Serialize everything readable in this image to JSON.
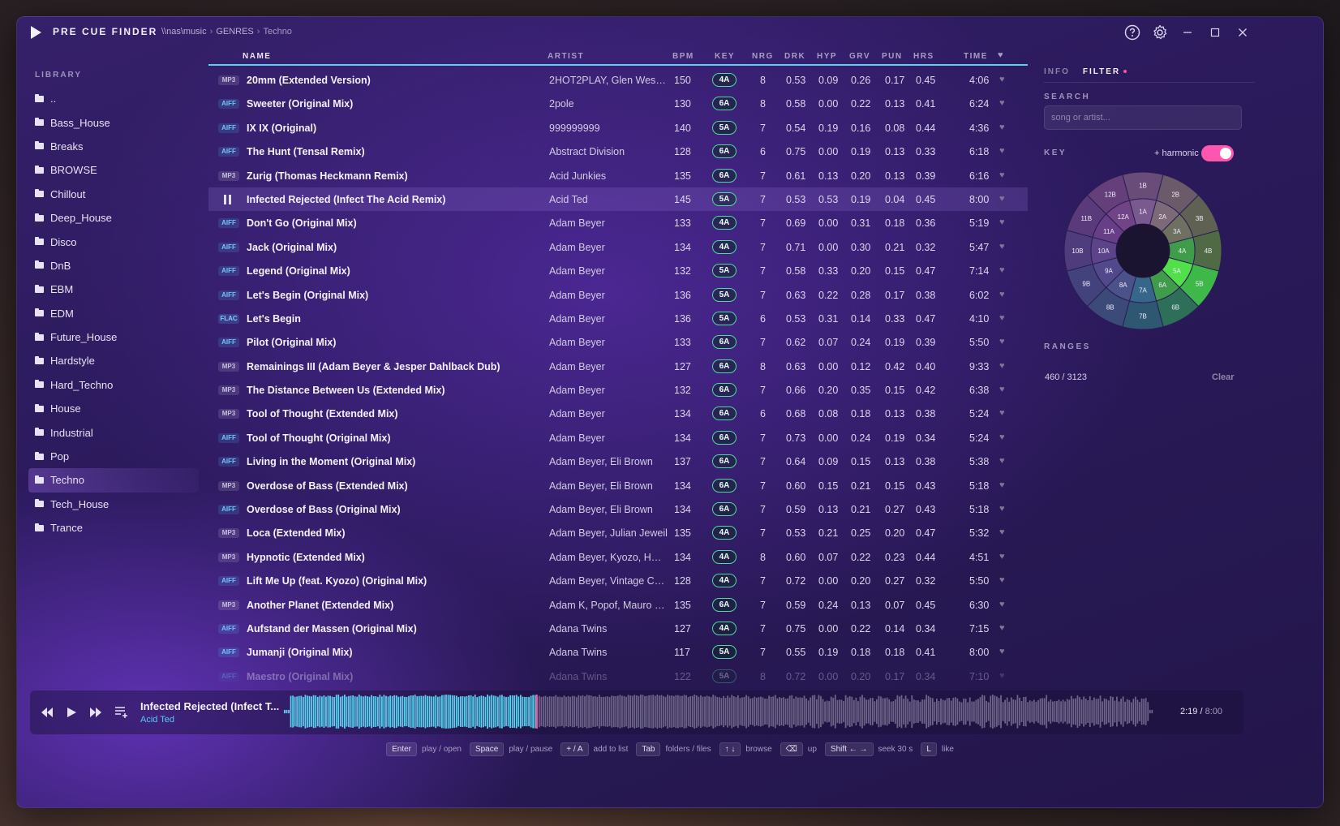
{
  "app": {
    "title": "PRE CUE FINDER"
  },
  "breadcrumb": [
    "\\\\nas\\music",
    "GENRES",
    "Techno"
  ],
  "library": {
    "heading": "LIBRARY",
    "items": [
      "..",
      "Bass_House",
      "Breaks",
      "BROWSE",
      "Chillout",
      "Deep_House",
      "Disco",
      "DnB",
      "EBM",
      "EDM",
      "Future_House",
      "Hardstyle",
      "Hard_Techno",
      "House",
      "Industrial",
      "Pop",
      "Techno",
      "Tech_House",
      "Trance"
    ],
    "active": "Techno"
  },
  "table": {
    "headers": {
      "name": "NAME",
      "artist": "ARTIST",
      "bpm": "BPM",
      "key": "KEY",
      "nrg": "NRG",
      "drk": "DRK",
      "hyp": "HYP",
      "grv": "GRV",
      "pun": "PUN",
      "hrs": "HRS",
      "time": "TIME"
    },
    "rows": [
      {
        "fmt": "MP3",
        "name": "20mm (Extended Version)",
        "artist": "2HOT2PLAY, Glen West ...",
        "bpm": "150",
        "key": "4A",
        "nrg": "8",
        "drk": "0.53",
        "hyp": "0.09",
        "grv": "0.26",
        "pun": "0.17",
        "hrs": "0.45",
        "time": "4:06"
      },
      {
        "fmt": "AIFF",
        "name": "Sweeter (Original Mix)",
        "artist": "2pole",
        "bpm": "130",
        "key": "6A",
        "nrg": "8",
        "drk": "0.58",
        "hyp": "0.00",
        "grv": "0.22",
        "pun": "0.13",
        "hrs": "0.41",
        "time": "6:24"
      },
      {
        "fmt": "AIFF",
        "name": "IX IX (Original)",
        "artist": "999999999",
        "bpm": "140",
        "key": "5A",
        "nrg": "7",
        "drk": "0.54",
        "hyp": "0.19",
        "grv": "0.16",
        "pun": "0.08",
        "hrs": "0.44",
        "time": "4:36"
      },
      {
        "fmt": "AIFF",
        "name": "The Hunt (Tensal Remix)",
        "artist": "Abstract Division",
        "bpm": "128",
        "key": "6A",
        "nrg": "6",
        "drk": "0.75",
        "hyp": "0.00",
        "grv": "0.19",
        "pun": "0.13",
        "hrs": "0.33",
        "time": "6:18"
      },
      {
        "fmt": "MP3",
        "name": "Zurig (Thomas Heckmann Remix)",
        "artist": "Acid Junkies",
        "bpm": "135",
        "key": "6A",
        "nrg": "7",
        "drk": "0.61",
        "hyp": "0.13",
        "grv": "0.20",
        "pun": "0.13",
        "hrs": "0.39",
        "time": "6:16"
      },
      {
        "fmt": "PLAYING",
        "name": "Infected Rejected (Infect The Acid Remix)",
        "artist": "Acid Ted",
        "bpm": "145",
        "key": "5A",
        "nrg": "7",
        "drk": "0.53",
        "hyp": "0.53",
        "grv": "0.19",
        "pun": "0.04",
        "hrs": "0.45",
        "time": "8:00"
      },
      {
        "fmt": "AIFF",
        "name": "Don't Go (Original Mix)",
        "artist": "Adam Beyer",
        "bpm": "133",
        "key": "4A",
        "nrg": "7",
        "drk": "0.69",
        "hyp": "0.00",
        "grv": "0.31",
        "pun": "0.18",
        "hrs": "0.36",
        "time": "5:19"
      },
      {
        "fmt": "AIFF",
        "name": "Jack (Original Mix)",
        "artist": "Adam Beyer",
        "bpm": "134",
        "key": "4A",
        "nrg": "7",
        "drk": "0.71",
        "hyp": "0.00",
        "grv": "0.30",
        "pun": "0.21",
        "hrs": "0.32",
        "time": "5:47"
      },
      {
        "fmt": "AIFF",
        "name": "Legend (Original Mix)",
        "artist": "Adam Beyer",
        "bpm": "132",
        "key": "5A",
        "nrg": "7",
        "drk": "0.58",
        "hyp": "0.33",
        "grv": "0.20",
        "pun": "0.15",
        "hrs": "0.47",
        "time": "7:14"
      },
      {
        "fmt": "AIFF",
        "name": "Let's Begin (Original Mix)",
        "artist": "Adam Beyer",
        "bpm": "136",
        "key": "5A",
        "nrg": "7",
        "drk": "0.63",
        "hyp": "0.22",
        "grv": "0.28",
        "pun": "0.17",
        "hrs": "0.38",
        "time": "6:02"
      },
      {
        "fmt": "FLAC",
        "name": "Let's Begin",
        "artist": "Adam Beyer",
        "bpm": "136",
        "key": "5A",
        "nrg": "6",
        "drk": "0.53",
        "hyp": "0.31",
        "grv": "0.14",
        "pun": "0.33",
        "hrs": "0.47",
        "time": "4:10"
      },
      {
        "fmt": "AIFF",
        "name": "Pilot (Original Mix)",
        "artist": "Adam Beyer",
        "bpm": "133",
        "key": "6A",
        "nrg": "7",
        "drk": "0.62",
        "hyp": "0.07",
        "grv": "0.24",
        "pun": "0.19",
        "hrs": "0.39",
        "time": "5:50"
      },
      {
        "fmt": "MP3",
        "name": "Remainings III (Adam Beyer & Jesper Dahlback Dub)",
        "artist": "Adam Beyer",
        "bpm": "127",
        "key": "6A",
        "nrg": "8",
        "drk": "0.63",
        "hyp": "0.00",
        "grv": "0.12",
        "pun": "0.42",
        "hrs": "0.40",
        "time": "9:33"
      },
      {
        "fmt": "MP3",
        "name": "The Distance Between Us (Extended Mix)",
        "artist": "Adam Beyer",
        "bpm": "132",
        "key": "6A",
        "nrg": "7",
        "drk": "0.66",
        "hyp": "0.20",
        "grv": "0.35",
        "pun": "0.15",
        "hrs": "0.42",
        "time": "6:38"
      },
      {
        "fmt": "MP3",
        "name": "Tool of Thought (Extended Mix)",
        "artist": "Adam Beyer",
        "bpm": "134",
        "key": "6A",
        "nrg": "6",
        "drk": "0.68",
        "hyp": "0.08",
        "grv": "0.18",
        "pun": "0.13",
        "hrs": "0.38",
        "time": "5:24"
      },
      {
        "fmt": "AIFF",
        "name": "Tool of Thought (Original Mix)",
        "artist": "Adam Beyer",
        "bpm": "134",
        "key": "6A",
        "nrg": "7",
        "drk": "0.73",
        "hyp": "0.00",
        "grv": "0.24",
        "pun": "0.19",
        "hrs": "0.34",
        "time": "5:24"
      },
      {
        "fmt": "AIFF",
        "name": "Living in the Moment (Original Mix)",
        "artist": "Adam Beyer, Eli Brown",
        "bpm": "137",
        "key": "6A",
        "nrg": "7",
        "drk": "0.64",
        "hyp": "0.09",
        "grv": "0.15",
        "pun": "0.13",
        "hrs": "0.38",
        "time": "5:38"
      },
      {
        "fmt": "MP3",
        "name": "Overdose of Bass (Extended Mix)",
        "artist": "Adam Beyer, Eli Brown",
        "bpm": "134",
        "key": "6A",
        "nrg": "7",
        "drk": "0.60",
        "hyp": "0.15",
        "grv": "0.21",
        "pun": "0.15",
        "hrs": "0.43",
        "time": "5:18"
      },
      {
        "fmt": "AIFF",
        "name": "Overdose of Bass (Original Mix)",
        "artist": "Adam Beyer, Eli Brown",
        "bpm": "134",
        "key": "6A",
        "nrg": "7",
        "drk": "0.59",
        "hyp": "0.13",
        "grv": "0.21",
        "pun": "0.27",
        "hrs": "0.43",
        "time": "5:18"
      },
      {
        "fmt": "MP3",
        "name": "Loca (Extended Mix)",
        "artist": "Adam Beyer, Julian Jeweil",
        "bpm": "135",
        "key": "4A",
        "nrg": "7",
        "drk": "0.53",
        "hyp": "0.21",
        "grv": "0.25",
        "pun": "0.20",
        "hrs": "0.47",
        "time": "5:32"
      },
      {
        "fmt": "MP3",
        "name": "Hypnotic (Extended Mix)",
        "artist": "Adam Beyer, Kyozo, HNTR",
        "bpm": "134",
        "key": "4A",
        "nrg": "8",
        "drk": "0.60",
        "hyp": "0.07",
        "grv": "0.22",
        "pun": "0.23",
        "hrs": "0.44",
        "time": "4:51"
      },
      {
        "fmt": "AIFF",
        "name": "Lift Me Up (feat. Kyozo) (Original Mix)",
        "artist": "Adam Beyer, Vintage Cul...",
        "bpm": "128",
        "key": "4A",
        "nrg": "7",
        "drk": "0.72",
        "hyp": "0.00",
        "grv": "0.20",
        "pun": "0.27",
        "hrs": "0.32",
        "time": "5:50"
      },
      {
        "fmt": "MP3",
        "name": "Another Planet (Extended Mix)",
        "artist": "Adam K, Popof, Mauro S...",
        "bpm": "135",
        "key": "6A",
        "nrg": "7",
        "drk": "0.59",
        "hyp": "0.24",
        "grv": "0.13",
        "pun": "0.07",
        "hrs": "0.45",
        "time": "6:30"
      },
      {
        "fmt": "AIFF",
        "name": "Aufstand der Massen (Original Mix)",
        "artist": "Adana Twins",
        "bpm": "127",
        "key": "4A",
        "nrg": "7",
        "drk": "0.75",
        "hyp": "0.00",
        "grv": "0.22",
        "pun": "0.14",
        "hrs": "0.34",
        "time": "7:15"
      },
      {
        "fmt": "AIFF",
        "name": "Jumanji (Original Mix)",
        "artist": "Adana Twins",
        "bpm": "117",
        "key": "5A",
        "nrg": "7",
        "drk": "0.55",
        "hyp": "0.19",
        "grv": "0.18",
        "pun": "0.18",
        "hrs": "0.41",
        "time": "8:00"
      },
      {
        "fmt": "AIFF",
        "name": "Maestro (Original Mix)",
        "artist": "Adana Twins",
        "bpm": "122",
        "key": "5A",
        "nrg": "8",
        "drk": "0.72",
        "hyp": "0.00",
        "grv": "0.20",
        "pun": "0.17",
        "hrs": "0.34",
        "time": "7:10"
      }
    ]
  },
  "panel": {
    "tab_info": "INFO",
    "tab_filter": "FILTER",
    "search_label": "SEARCH",
    "search_placeholder": "song or artist...",
    "key_label": "KEY",
    "harmonic_label": "+ harmonic",
    "harmonic_on": true,
    "ranges_label": "RANGES",
    "count": "460 / 3123",
    "clear_label": "Clear",
    "wheel": {
      "outer": [
        "1B",
        "2B",
        "3B",
        "4B",
        "5B",
        "6B",
        "7B",
        "8B",
        "9B",
        "10B",
        "11B",
        "12B"
      ],
      "inner": [
        "1A",
        "2A",
        "3A",
        "4A",
        "5A",
        "6A",
        "7A",
        "8A",
        "9A",
        "10A",
        "11A",
        "12A"
      ],
      "selected": "5A",
      "harmonic": [
        "4A",
        "6A",
        "5B"
      ]
    }
  },
  "player": {
    "title": "Infected Rejected (Infect T...",
    "artist": "Acid Ted",
    "elapsed": "2:19",
    "total": "8:00",
    "progress": 0.29
  },
  "hints": [
    {
      "key": "Enter",
      "label": "play / open"
    },
    {
      "key": "Space",
      "label": "play / pause"
    },
    {
      "key": "+ / A",
      "label": "add to list"
    },
    {
      "key": "Tab",
      "label": "folders / files"
    },
    {
      "key": "↑ ↓",
      "label": "browse"
    },
    {
      "key": "⌫",
      "label": "up"
    },
    {
      "key": "Shift ← →",
      "label": "seek 30 s"
    },
    {
      "key": "L",
      "label": "like"
    }
  ],
  "colors": {
    "accent": "#5bd1ef",
    "pink": "#ff56b0",
    "key_green": "#50d8a0"
  }
}
